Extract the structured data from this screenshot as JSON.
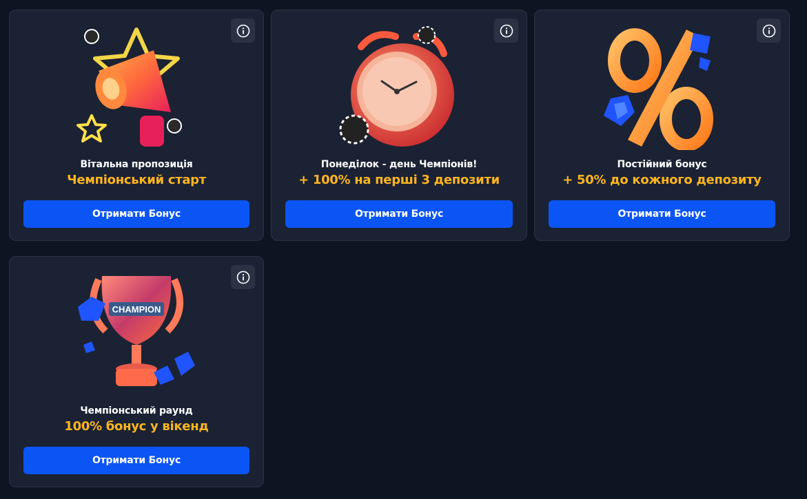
{
  "colors": {
    "background": "#0e1522",
    "card": "#1b2233",
    "accent_title": "#ffb520",
    "button": "#0b55f5"
  },
  "cards": [
    {
      "image_icon": "megaphone-icon",
      "subtitle": "Вітальна пропозиція",
      "title": "Чемпіонський старт",
      "button_label": "Отримати Бонус",
      "info_icon": "info-icon"
    },
    {
      "image_icon": "alarm-clock-icon",
      "subtitle": "Понеділок - день Чемпіонів!",
      "title": "+ 100% на перші 3 депозити",
      "button_label": "Отримати Бонус",
      "info_icon": "info-icon"
    },
    {
      "image_icon": "percent-icon",
      "subtitle": "Постійний бонус",
      "title": "+ 50% до кожного депозиту",
      "button_label": "Отримати Бонус",
      "info_icon": "info-icon"
    },
    {
      "image_icon": "trophy-icon",
      "subtitle": "Чемпіонський раунд",
      "title": "100% бонус у вікенд",
      "button_label": "Отримати Бонус",
      "info_icon": "info-icon",
      "trophy_text": "CHAMPION"
    }
  ]
}
